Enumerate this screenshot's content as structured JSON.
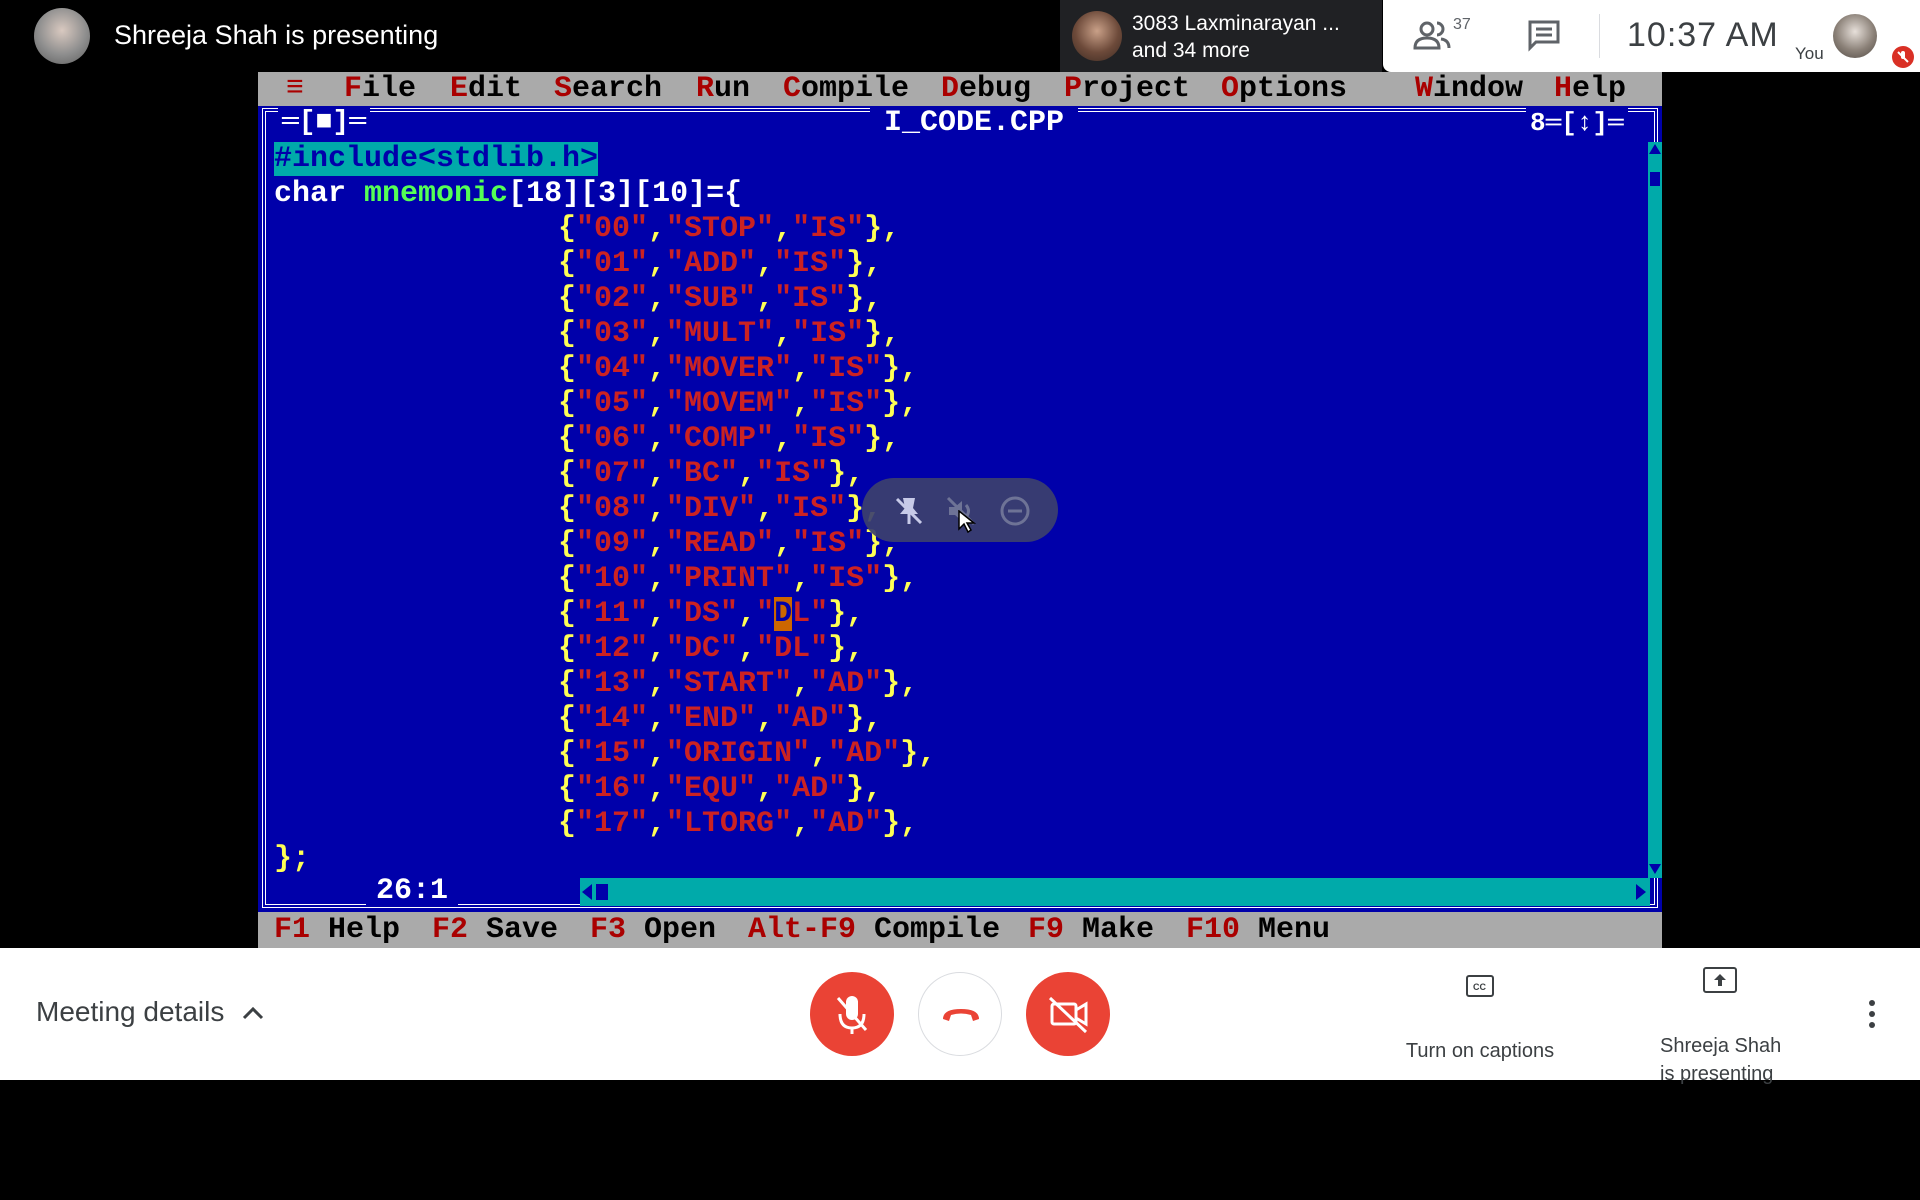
{
  "top": {
    "presenter_status": "Shreeja Shah is presenting",
    "participant_line1": "3083 Laxminarayan ...",
    "participant_line2": "and 34 more",
    "people_count": "37",
    "clock": "10:37  AM",
    "you_label": "You"
  },
  "ide": {
    "menu": [
      "≡",
      "File",
      "Edit",
      "Search",
      "Run",
      "Compile",
      "Debug",
      "Project",
      "Options",
      "Window",
      "Help"
    ],
    "menu_hotkeys": [
      "",
      "F",
      "E",
      "S",
      "R",
      "C",
      "D",
      "P",
      "O",
      "W",
      "H"
    ],
    "menu_rest": [
      "",
      "ile",
      "dit",
      "earch",
      "un",
      "ompile",
      "ebug",
      "roject",
      "ptions",
      "indow",
      "elp"
    ],
    "close_box": "═[■]═",
    "file_title": "I_CODE.CPP",
    "window_number": "8═[↕]═",
    "code": {
      "line1": "#include<stdlib.h>",
      "line2_kw": "char",
      "line2_id": "mnemonic",
      "line2_rest": "[18][3][10]={",
      "rows": [
        {
          "a": "00",
          "b": "STOP",
          "c": "IS"
        },
        {
          "a": "01",
          "b": "ADD",
          "c": "IS"
        },
        {
          "a": "02",
          "b": "SUB",
          "c": "IS"
        },
        {
          "a": "03",
          "b": "MULT",
          "c": "IS"
        },
        {
          "a": "04",
          "b": "MOVER",
          "c": "IS"
        },
        {
          "a": "05",
          "b": "MOVEM",
          "c": "IS"
        },
        {
          "a": "06",
          "b": "COMP",
          "c": "IS"
        },
        {
          "a": "07",
          "b": "BC",
          "c": "IS"
        },
        {
          "a": "08",
          "b": "DIV",
          "c": "IS"
        },
        {
          "a": "09",
          "b": "READ",
          "c": "IS"
        },
        {
          "a": "10",
          "b": "PRINT",
          "c": "IS"
        },
        {
          "a": "11",
          "b": "DS",
          "c": "DL"
        },
        {
          "a": "12",
          "b": "DC",
          "c": "DL"
        },
        {
          "a": "13",
          "b": "START",
          "c": "AD"
        },
        {
          "a": "14",
          "b": "END",
          "c": "AD"
        },
        {
          "a": "15",
          "b": "ORIGIN",
          "c": "AD"
        },
        {
          "a": "16",
          "b": "EQU",
          "c": "AD"
        },
        {
          "a": "17",
          "b": "LTORG",
          "c": "AD"
        }
      ],
      "closing": "};"
    },
    "cursor_position": "26:1",
    "status_keys": [
      {
        "key": "F1",
        "label": "Help"
      },
      {
        "key": "F2",
        "label": "Save"
      },
      {
        "key": "F3",
        "label": "Open"
      },
      {
        "key": "Alt-F9",
        "label": "Compile"
      },
      {
        "key": "F9",
        "label": "Make"
      },
      {
        "key": "F10",
        "label": "Menu"
      }
    ]
  },
  "bottom": {
    "meeting_details": "Meeting details",
    "captions": "Turn on captions",
    "presenting": "Shreeja Shah\nis presenting"
  },
  "colors": {
    "ide_background": "#0000aa",
    "ide_menu": "#aaaaaa",
    "meet_red": "#ea4335"
  }
}
